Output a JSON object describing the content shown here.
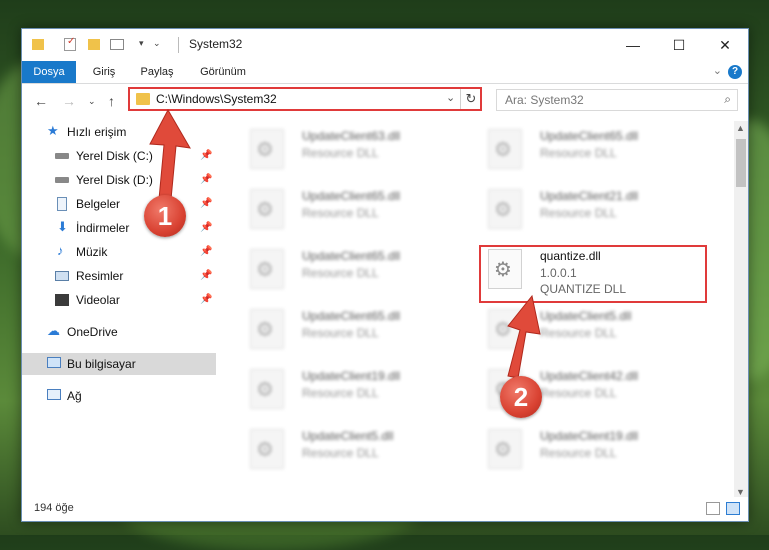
{
  "window": {
    "title": "System32",
    "controls": {
      "minimize": "—",
      "maximize": "☐",
      "close": "✕"
    }
  },
  "ribbon": {
    "tabs": [
      "Dosya",
      "Giriş",
      "Paylaş",
      "Görünüm"
    ],
    "help": "?"
  },
  "navbar": {
    "address": "C:\\Windows\\System32",
    "search_placeholder": "Ara: System32"
  },
  "sidebar": {
    "quick_access": "Hızlı erişim",
    "items": [
      {
        "label": "Yerel Disk (C:)",
        "icon": "drive-icon"
      },
      {
        "label": "Yerel Disk (D:)",
        "icon": "drive-icon"
      },
      {
        "label": "Belgeler",
        "icon": "documents-icon"
      },
      {
        "label": "İndirmeler",
        "icon": "downloads-icon"
      },
      {
        "label": "Müzik",
        "icon": "music-icon"
      },
      {
        "label": "Resimler",
        "icon": "pictures-icon"
      },
      {
        "label": "Videolar",
        "icon": "videos-icon"
      }
    ],
    "onedrive": "OneDrive",
    "this_pc": "Bu bilgisayar",
    "network": "Ağ"
  },
  "files": [
    {
      "name": "UpdateClient63.dll",
      "type": "Resource DLL"
    },
    {
      "name": "UpdateClient65.dll",
      "type": "Resource DLL"
    },
    {
      "name": "UpdateClient65.dll",
      "type": "Resource DLL"
    },
    {
      "name": "UpdateClient21.dll",
      "type": "Resource DLL"
    },
    {
      "name": "UpdateClient65.dll",
      "type": "Resource DLL"
    },
    {
      "name": "quantize.dll",
      "version": "1.0.0.1",
      "type": "QUANTIZE DLL"
    },
    {
      "name": "UpdateClient65.dll",
      "type": "Resource DLL"
    },
    {
      "name": "UpdateClient5.dll",
      "type": "Resource DLL"
    },
    {
      "name": "UpdateClient19.dll",
      "type": "Resource DLL"
    },
    {
      "name": "UpdateClient42.dll",
      "type": "Resource DLL"
    },
    {
      "name": "UpdateClient5.dll",
      "type": "Resource DLL"
    },
    {
      "name": "UpdateClient19.dll",
      "type": "Resource DLL"
    }
  ],
  "status": {
    "count": "194 öğe"
  },
  "annotations": {
    "marker1": "1",
    "marker2": "2",
    "color": "#e03a3a"
  }
}
